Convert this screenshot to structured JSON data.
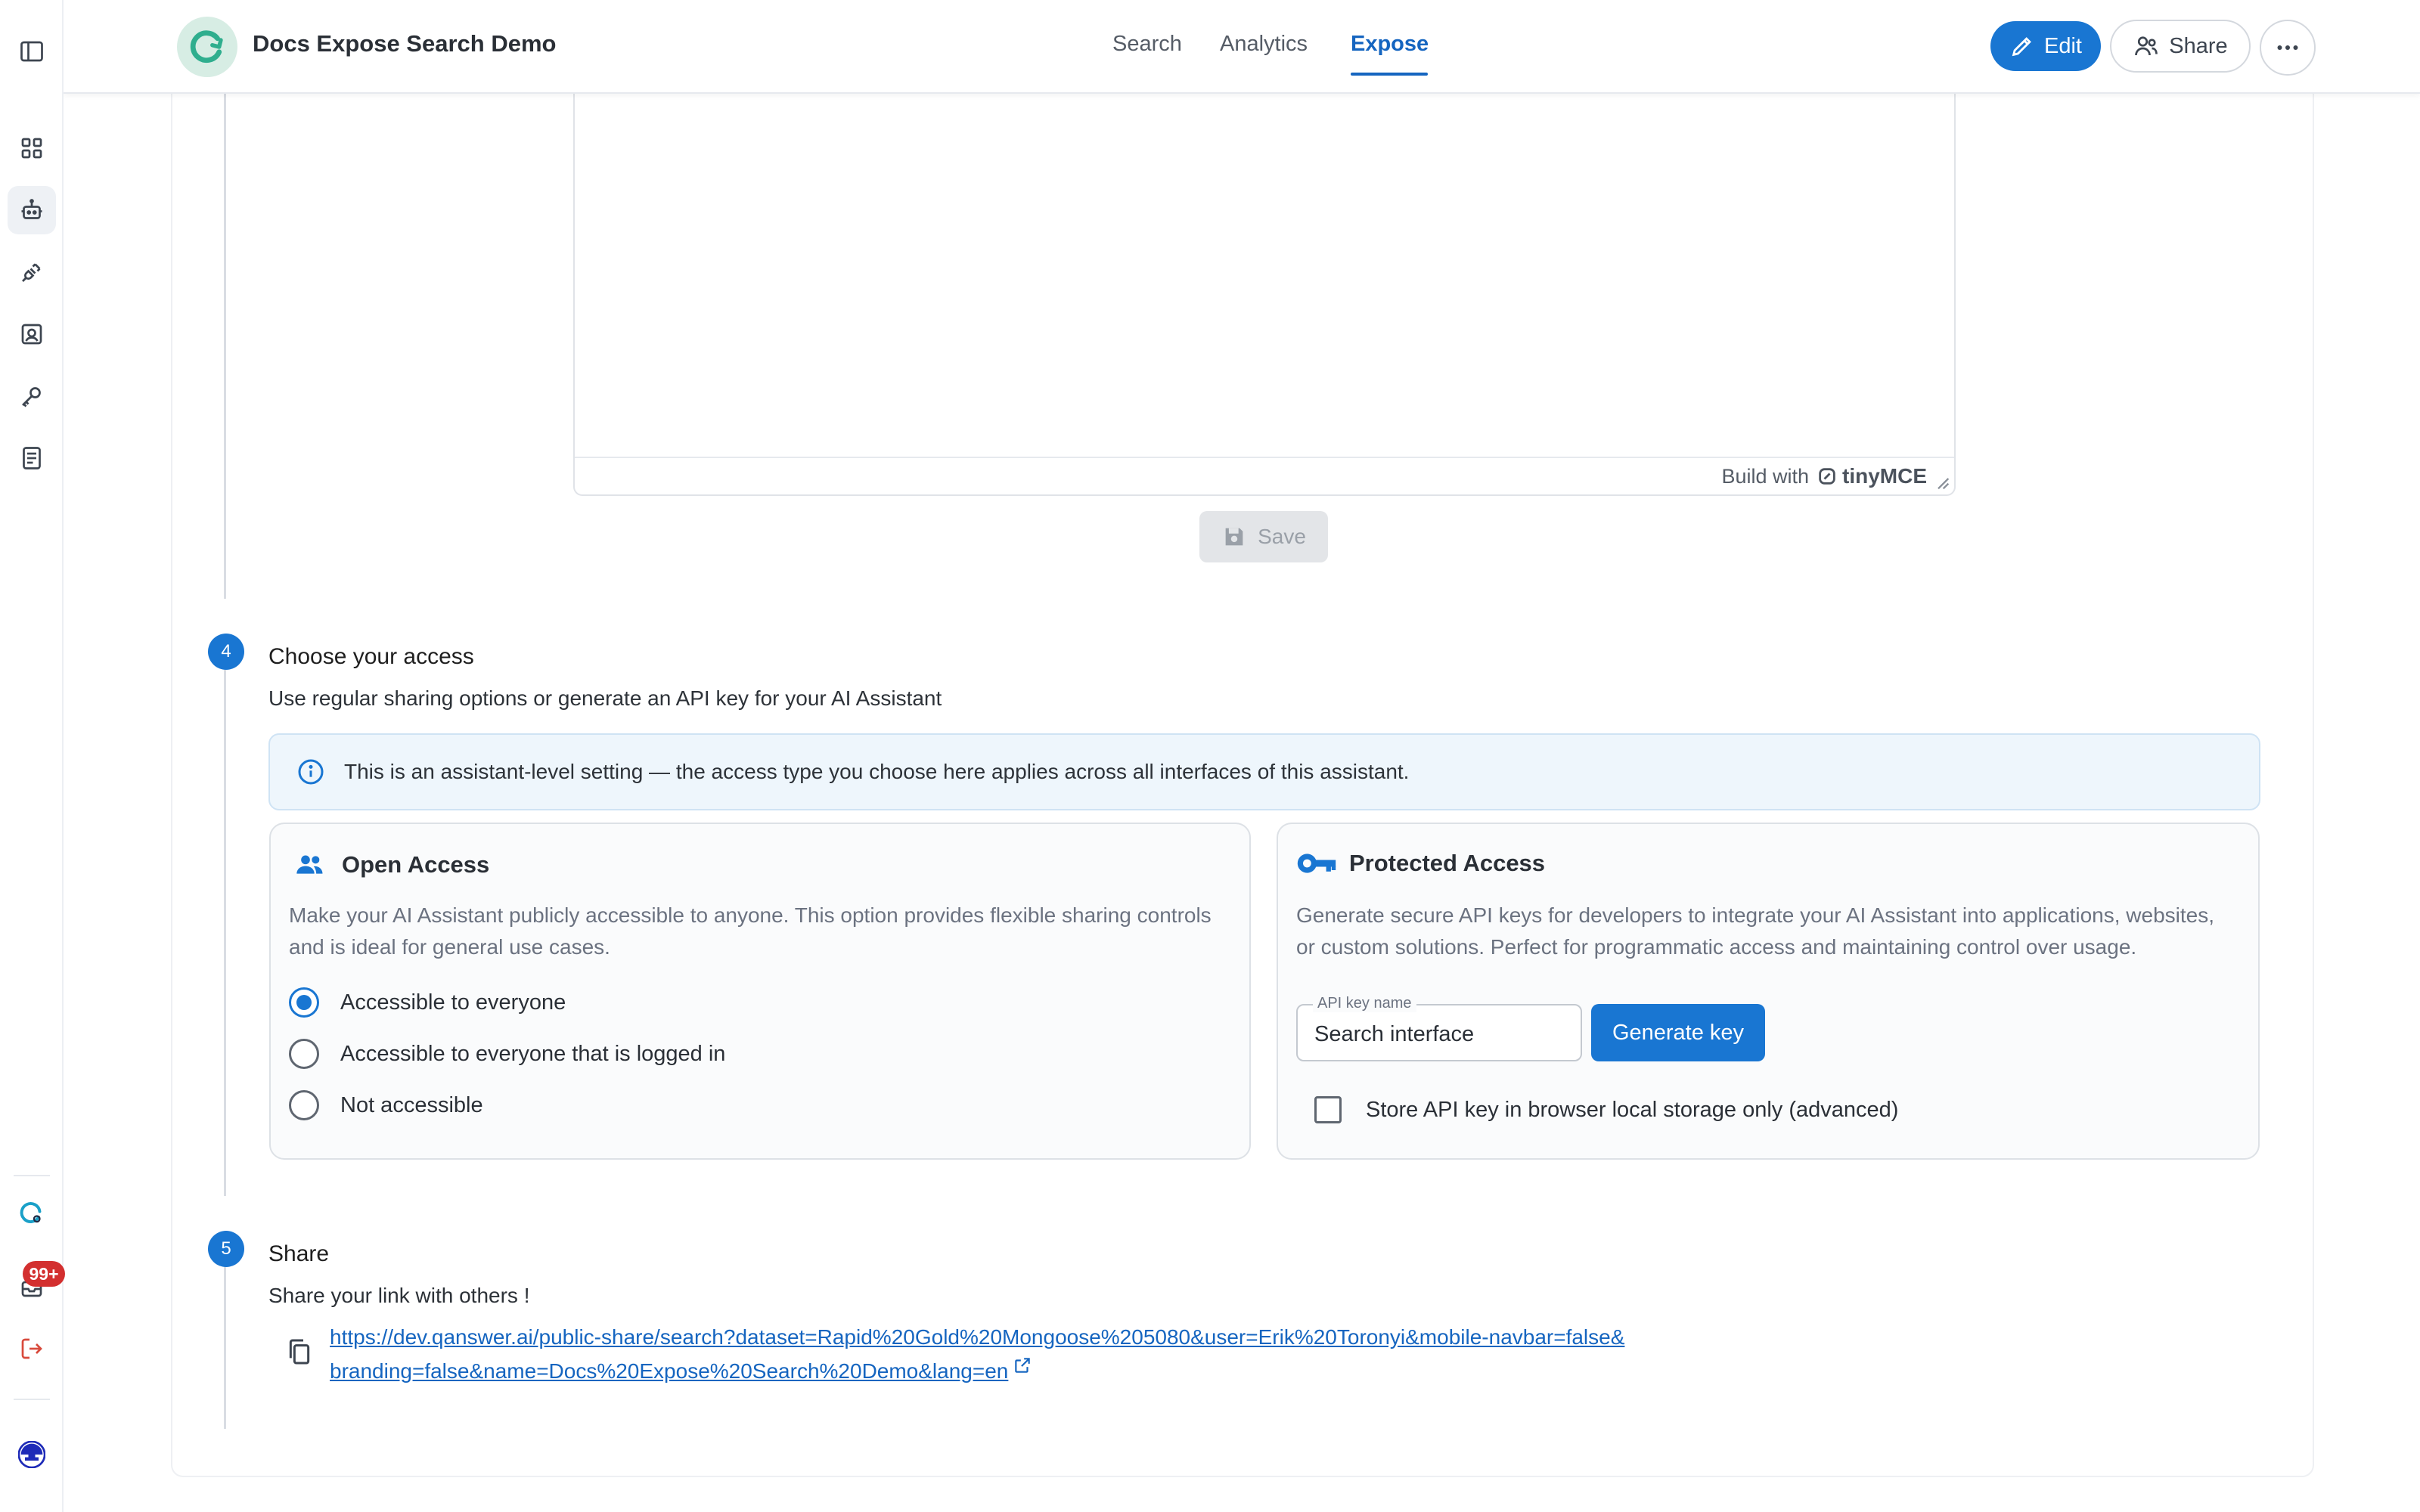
{
  "header": {
    "app_title": "Docs Expose Search Demo",
    "tabs": [
      {
        "label": "Search",
        "active": false
      },
      {
        "label": "Analytics",
        "active": false
      },
      {
        "label": "Expose",
        "active": true
      }
    ],
    "edit_label": "Edit",
    "share_label": "Share"
  },
  "sidebar": {
    "items": [
      {
        "icon": "panel-toggle-icon"
      },
      {
        "icon": "grid-icon"
      },
      {
        "icon": "robot-icon",
        "active": true
      },
      {
        "icon": "plug-icon"
      },
      {
        "icon": "scan-icon"
      },
      {
        "icon": "key-icon"
      },
      {
        "icon": "document-icon"
      }
    ],
    "notification_count": "99+"
  },
  "editor": {
    "branding_prefix": "Build with",
    "branding_name": "tinyMCE",
    "save_label": "Save"
  },
  "step4": {
    "number": "4",
    "title": "Choose your access",
    "subtitle": "Use regular sharing options or generate an API key for your AI Assistant",
    "info": "This is an assistant-level setting — the access type you choose here applies across all interfaces of this assistant.",
    "open_access": {
      "title": "Open Access",
      "description": "Make your AI Assistant publicly accessible to anyone. This option provides flexible sharing controls and is ideal for general use cases.",
      "options": [
        {
          "label": "Accessible to everyone",
          "selected": true
        },
        {
          "label": "Accessible to everyone that is logged in",
          "selected": false
        },
        {
          "label": "Not accessible",
          "selected": false
        }
      ]
    },
    "protected_access": {
      "title": "Protected Access",
      "description": "Generate secure API keys for developers to integrate your AI Assistant into applications, websites, or custom solutions. Perfect for programmatic access and maintaining control over usage.",
      "api_key_label": "API key name",
      "api_key_value": "Search interface",
      "generate_label": "Generate key",
      "store_label": "Store API key in browser local storage only (advanced)",
      "store_checked": false
    }
  },
  "step5": {
    "number": "5",
    "title": "Share",
    "subtitle": "Share your link with others !",
    "link": "https://dev.qanswer.ai/public-share/search?dataset=Rapid%20Gold%20Mongoose%205080&user=Erik%20Toronyi&mobile-navbar=false&branding=false&name=Docs%20Expose%20Search%20Demo&lang=en"
  },
  "colors": {
    "primary": "#1976d2",
    "link": "#1565c0",
    "badge": "#d32f2f",
    "info_bg": "#eef6fc"
  }
}
